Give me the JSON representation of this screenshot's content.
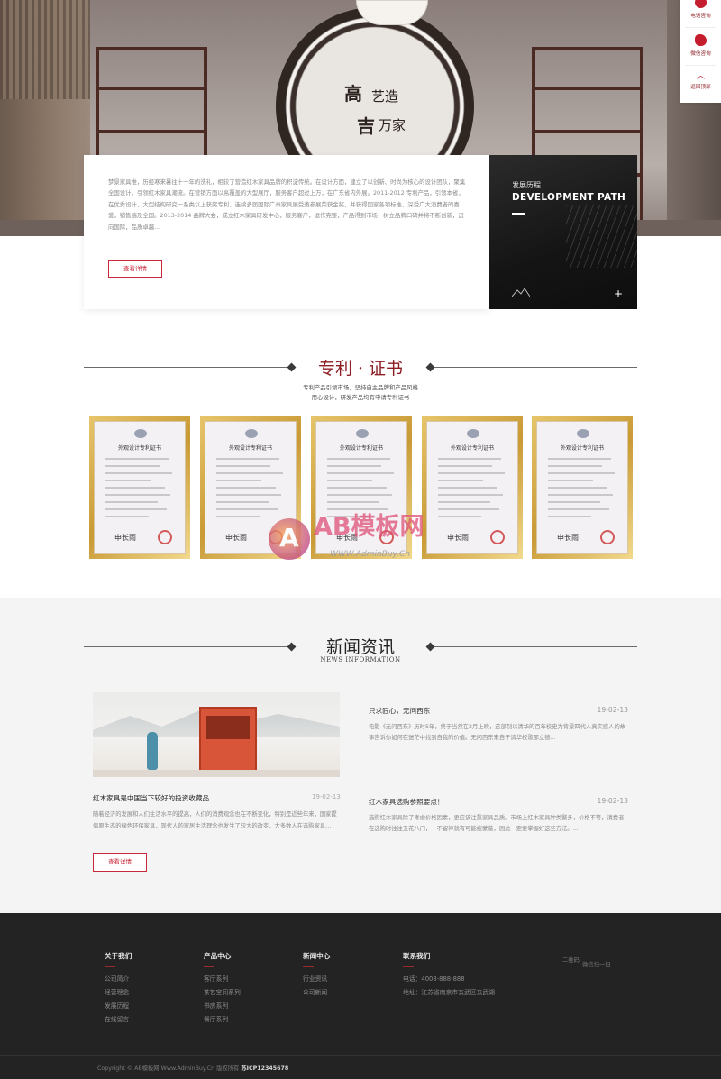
{
  "hero": {
    "calligraphy": [
      "高",
      "艺造",
      "吉",
      "万家"
    ]
  },
  "about": {
    "text": "梦景家具推，历经寒来暑往十一年的洗礼，相较了营造红木家具品牌的积淀传统。在设计方面，建立了以创新、时尚为核心的设计团队，聚集全国设计，引领红木家具潮流。在营销方面以高覆盖的大型展厅，服务客户超过上万，在广东省内外展。2011-2012 专利产品，引领本省，在优秀设计，大型结构研究一系类以上获奖专利，连续多届国际广州家具展受邀参展荣获金奖，并获得国家各项标准，深受广大消费者的喜爱，销售遍及全国。2013-2014 品牌大会，成立红木家具研发中心，服务客户，运作完整，产品得到市场，树立品牌口碑并将不断创新，迈向国际，品质卓越...",
    "button": "查看详情"
  },
  "dev": {
    "cn": "发展历程",
    "en": "DEVELOPMENT PATH",
    "plus": "+"
  },
  "patent": {
    "title": "专利 · 证书",
    "desc_line1": "专利产品引领市场，坚持自主品牌和产品风格",
    "desc_line2": "用心设计，研发产品均有申请专利证书",
    "cert_title": "外观设计专利证书",
    "cert_sig": "申长雨",
    "cert_count": 5
  },
  "watermark": {
    "brand": "AB模板网",
    "url": "WWW.AdminBuy.Cn",
    "letter": "A"
  },
  "news": {
    "title": "新闻资讯",
    "subtitle": "NEWS INFORMATION",
    "main": {
      "title": "红木家具是中国当下较好的投资收藏品",
      "date": "19-02-13",
      "desc": "随着经济的发展和人们生活水平的提高，人们的消费观念也在不断变化，特别是近些年来，国家提倡原生态的绿色环保家具，现代人的家居生活理念也发生了较大的改变，大多数人在选购家具…",
      "button": "查看详情"
    },
    "items": [
      {
        "title": "只求匠心，无问西东",
        "date": "19-02-13",
        "desc": "电影《无问西东》历时5年，终于当然在2月上映，这部制以清华的百年校史为背景四代人真实感人的故事告诉你如何在迷茫中找到自我的价值。无问西东来自于清华校歌那立德..."
      },
      {
        "title": "红木家具选购参照要点！",
        "date": "19-02-13",
        "desc": "选购红木家具除了考虑价格因素，更应该注重家具品质。市场上红木家具种类繁多，价格不等，消费者在选购时往往五花八门，一不留神就有可能被蒙蔽，因此一定要掌握好这些方法。..."
      }
    ]
  },
  "footer": {
    "cols": [
      {
        "title": "关于我们",
        "items": [
          "公司简介",
          "经营理念",
          "发展历程",
          "在线留言"
        ]
      },
      {
        "title": "产品中心",
        "items": [
          "客厅系列",
          "茶艺空间系列",
          "书房系列",
          "餐厅系列"
        ]
      },
      {
        "title": "新闻中心",
        "items": [
          "行业资讯",
          "公司新闻"
        ]
      },
      {
        "title": "联系我们",
        "items": [
          "电话：4008-888-888",
          "地址：江苏省南京市玄武区玄武湖"
        ]
      }
    ],
    "qr_alt": "二维码",
    "qr_caption": "微信扫一扫",
    "copyright": "Copyright © AB模板网 Www.AdminBuy.Cn 版权所有",
    "icp": "苏ICP12345678"
  },
  "side": {
    "phone": "电话咨询",
    "wechat": "微信咨询",
    "top": "返回顶部",
    "arrow": "︿"
  },
  "colors": {
    "accent": "#8c1e24",
    "button": "#c7283a",
    "footer_bg": "#232323",
    "news_bg": "#f5f4f4"
  }
}
